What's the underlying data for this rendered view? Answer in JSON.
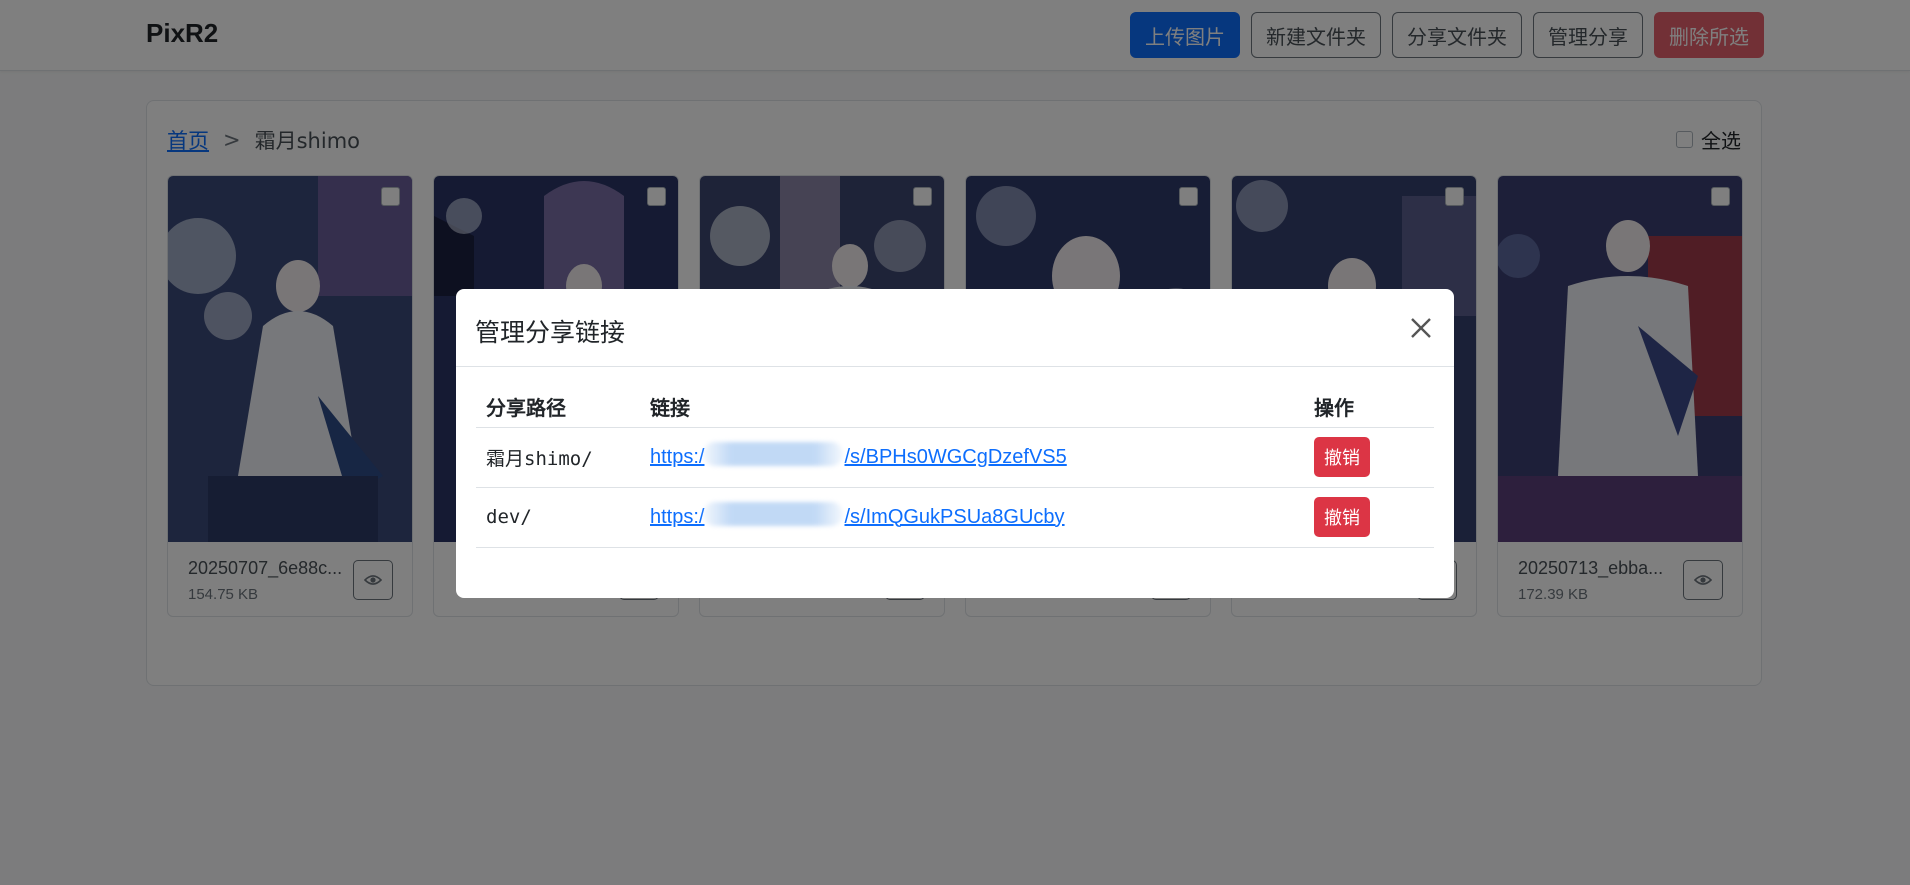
{
  "app": {
    "brand": "PixR2"
  },
  "toolbar": {
    "upload_label": "上传图片",
    "new_folder_label": "新建文件夹",
    "share_folder_label": "分享文件夹",
    "manage_share_label": "管理分享",
    "delete_selected_label": "删除所选"
  },
  "breadcrumb": {
    "home": "首页",
    "separator": ">",
    "current": "霜月shimo"
  },
  "select_all_label": "全选",
  "cards": [
    {
      "name": "20250707_6e88c...",
      "size": "154.75 KB"
    },
    {
      "name": "",
      "size": ""
    },
    {
      "name": "",
      "size": ""
    },
    {
      "name": "",
      "size": ""
    },
    {
      "name": "",
      "size": ""
    },
    {
      "name": "20250713_ebba...",
      "size": "172.39 KB"
    }
  ],
  "modal": {
    "title": "管理分享链接",
    "columns": {
      "path": "分享路径",
      "link": "链接",
      "action": "操作"
    },
    "rows": [
      {
        "path": "霜月shimo/",
        "link_prefix": "https:/",
        "link_suffix": "/s/BPHs0WGCgDzefVS5",
        "action": "撤销"
      },
      {
        "path": "dev/",
        "link_prefix": "https:/",
        "link_suffix": "/s/ImQGukPSUa8GUcby",
        "action": "撤销"
      }
    ]
  },
  "colors": {
    "primary": "#0d6efd",
    "danger": "#dc3545"
  }
}
